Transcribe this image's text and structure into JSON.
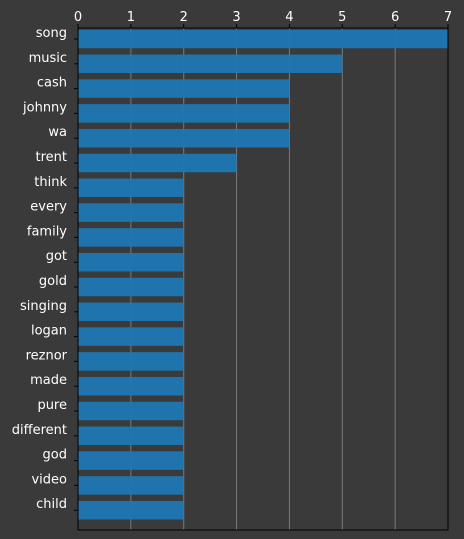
{
  "chart_data": {
    "type": "bar",
    "orientation": "horizontal",
    "categories": [
      "song",
      "music",
      "cash",
      "johnny",
      "wa",
      "trent",
      "think",
      "every",
      "family",
      "got",
      "gold",
      "singing",
      "logan",
      "reznor",
      "made",
      "pure",
      "different",
      "god",
      "video",
      "child"
    ],
    "values": [
      7,
      5,
      4,
      4,
      4,
      3,
      2,
      2,
      2,
      2,
      2,
      2,
      2,
      2,
      2,
      2,
      2,
      2,
      2,
      2
    ],
    "xlim": [
      0,
      7
    ],
    "xticks": [
      "0",
      "1",
      "2",
      "3",
      "4",
      "5",
      "6",
      "7"
    ],
    "x_axis_position": "top",
    "grid": true,
    "title": "",
    "xlabel": "",
    "ylabel": "",
    "colors": {
      "bar": "#1f77b4",
      "background": "#3a3a3a",
      "grid": "#7a7a7a",
      "axis": "#000000",
      "text": "#ffffff"
    }
  }
}
